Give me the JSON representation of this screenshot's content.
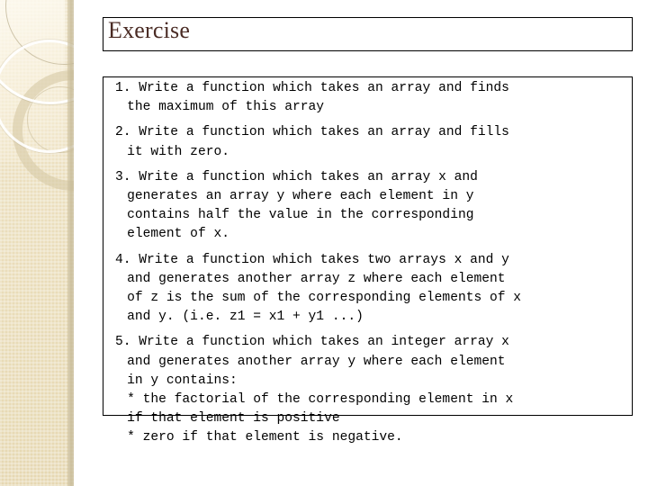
{
  "slide": {
    "title": "Exercise",
    "accent_color": "#4a2b24",
    "sidebar_color": "#ece0c0",
    "border_color": "#000000",
    "background_color": "#ffffff"
  },
  "exercises": [
    {
      "number": "1.",
      "lines": [
        "1. Write a function which takes an array and finds",
        "the maximum of this array"
      ]
    },
    {
      "number": "2.",
      "lines": [
        "2. Write a function which takes an array and fills",
        "it with zero."
      ]
    },
    {
      "number": "3.",
      "lines": [
        "3. Write a function which takes an array x and",
        "generates an array y where each element in y",
        "contains half the value in the corresponding",
        "element of x."
      ]
    },
    {
      "number": "4.",
      "lines": [
        "4. Write a function which takes two arrays x and y",
        "and generates another array z where each element",
        "of z is the sum of the corresponding elements of x",
        "and y. (i.e. z1 = x1 + y1 ...)"
      ]
    },
    {
      "number": "5.",
      "lines": [
        "5. Write a function which takes an integer array x",
        "and generates another array y where each element",
        "in y contains:",
        "* the factorial of the corresponding element in x",
        "if that element is positive",
        "* zero if that element is negative."
      ]
    }
  ]
}
